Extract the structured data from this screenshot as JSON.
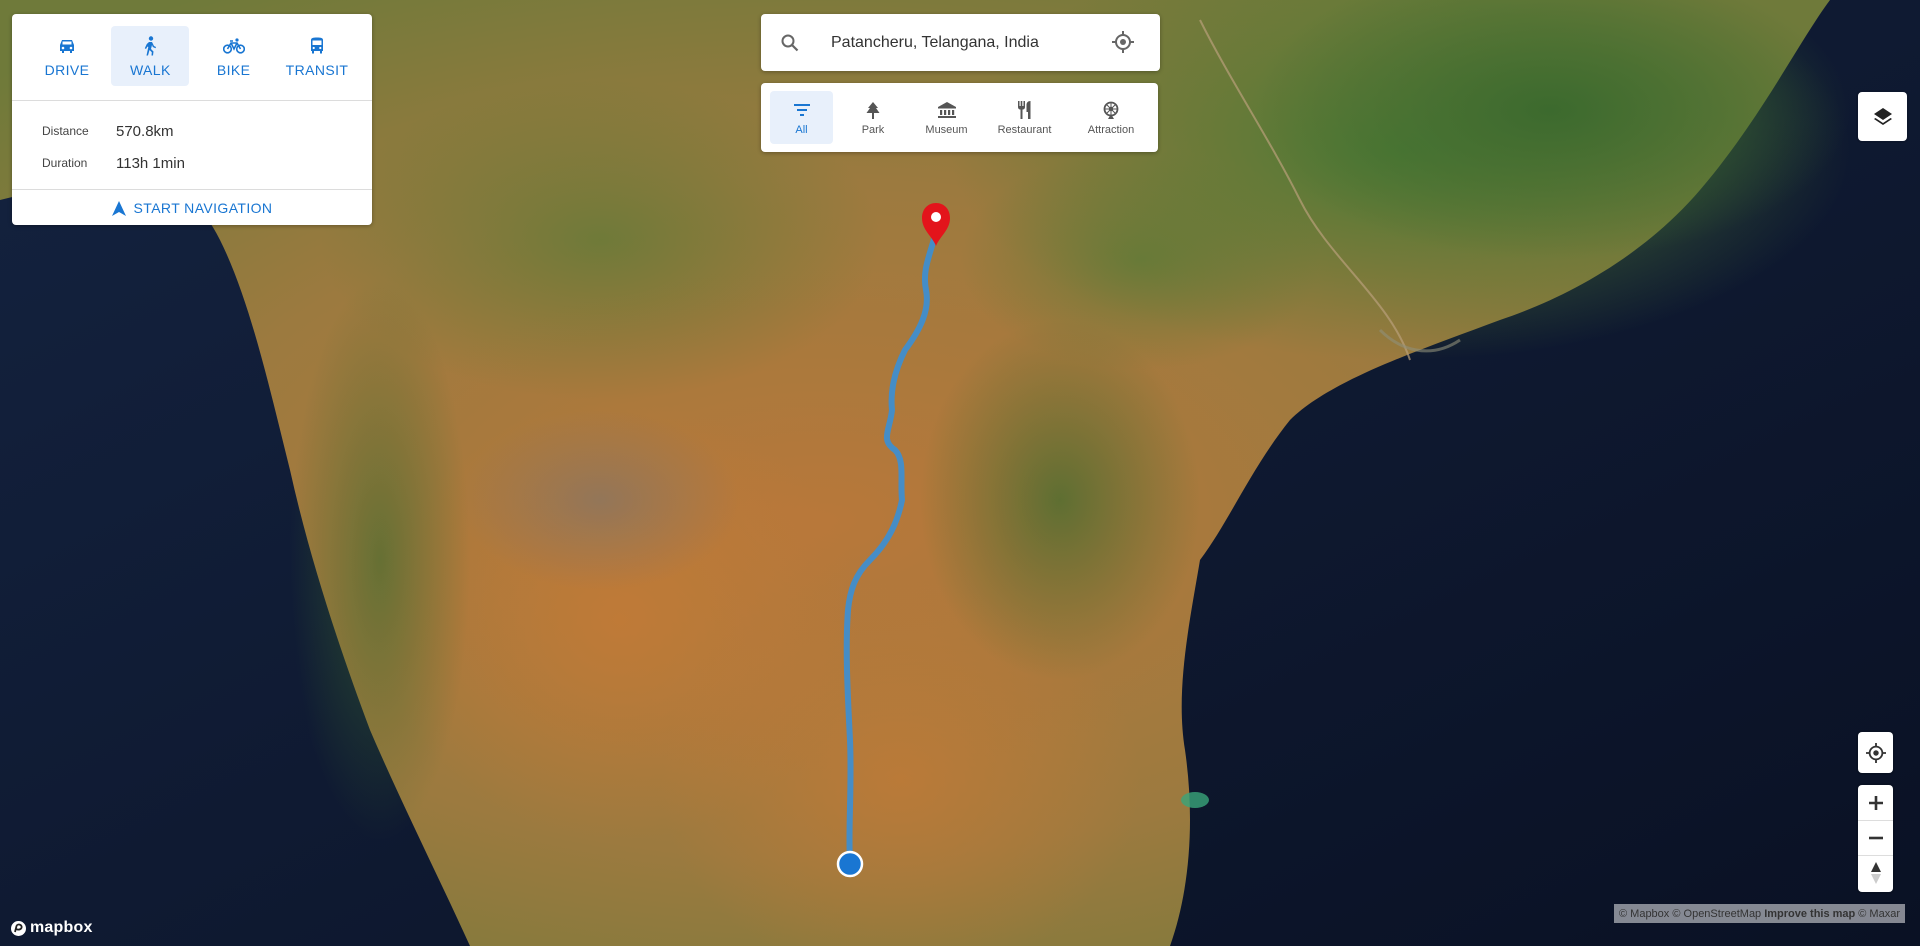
{
  "app": {
    "colors": {
      "accent": "#1976d2",
      "route": "#3a8fd6",
      "marker": "#e3141b",
      "origin": "#1976d2"
    }
  },
  "directions": {
    "modes": [
      {
        "label": "DRIVE",
        "icon": "car-icon",
        "active": false
      },
      {
        "label": "WALK",
        "icon": "walk-icon",
        "active": true
      },
      {
        "label": "BIKE",
        "icon": "bike-icon",
        "active": false
      },
      {
        "label": "TRANSIT",
        "icon": "bus-icon",
        "active": false
      }
    ],
    "distance_label": "Distance",
    "distance_value": "570.8km",
    "duration_label": "Duration",
    "duration_value": "113h 1min",
    "start_navigation": "START NAVIGATION"
  },
  "search": {
    "value": "Patancheru, Telangana, India"
  },
  "categories": [
    {
      "label": "All",
      "icon": "filter-icon",
      "active": true
    },
    {
      "label": "Park",
      "icon": "tree-icon",
      "active": false
    },
    {
      "label": "Museum",
      "icon": "museum-icon",
      "active": false
    },
    {
      "label": "Restaurant",
      "icon": "restaurant-icon",
      "active": false
    },
    {
      "label": "Attraction",
      "icon": "attraction-icon",
      "active": false
    }
  ],
  "attribution": {
    "mapbox": "© Mapbox",
    "osm": "© OpenStreetMap",
    "improve": "Improve this map",
    "maxar": "© Maxar"
  },
  "logo_text": "mapbox"
}
